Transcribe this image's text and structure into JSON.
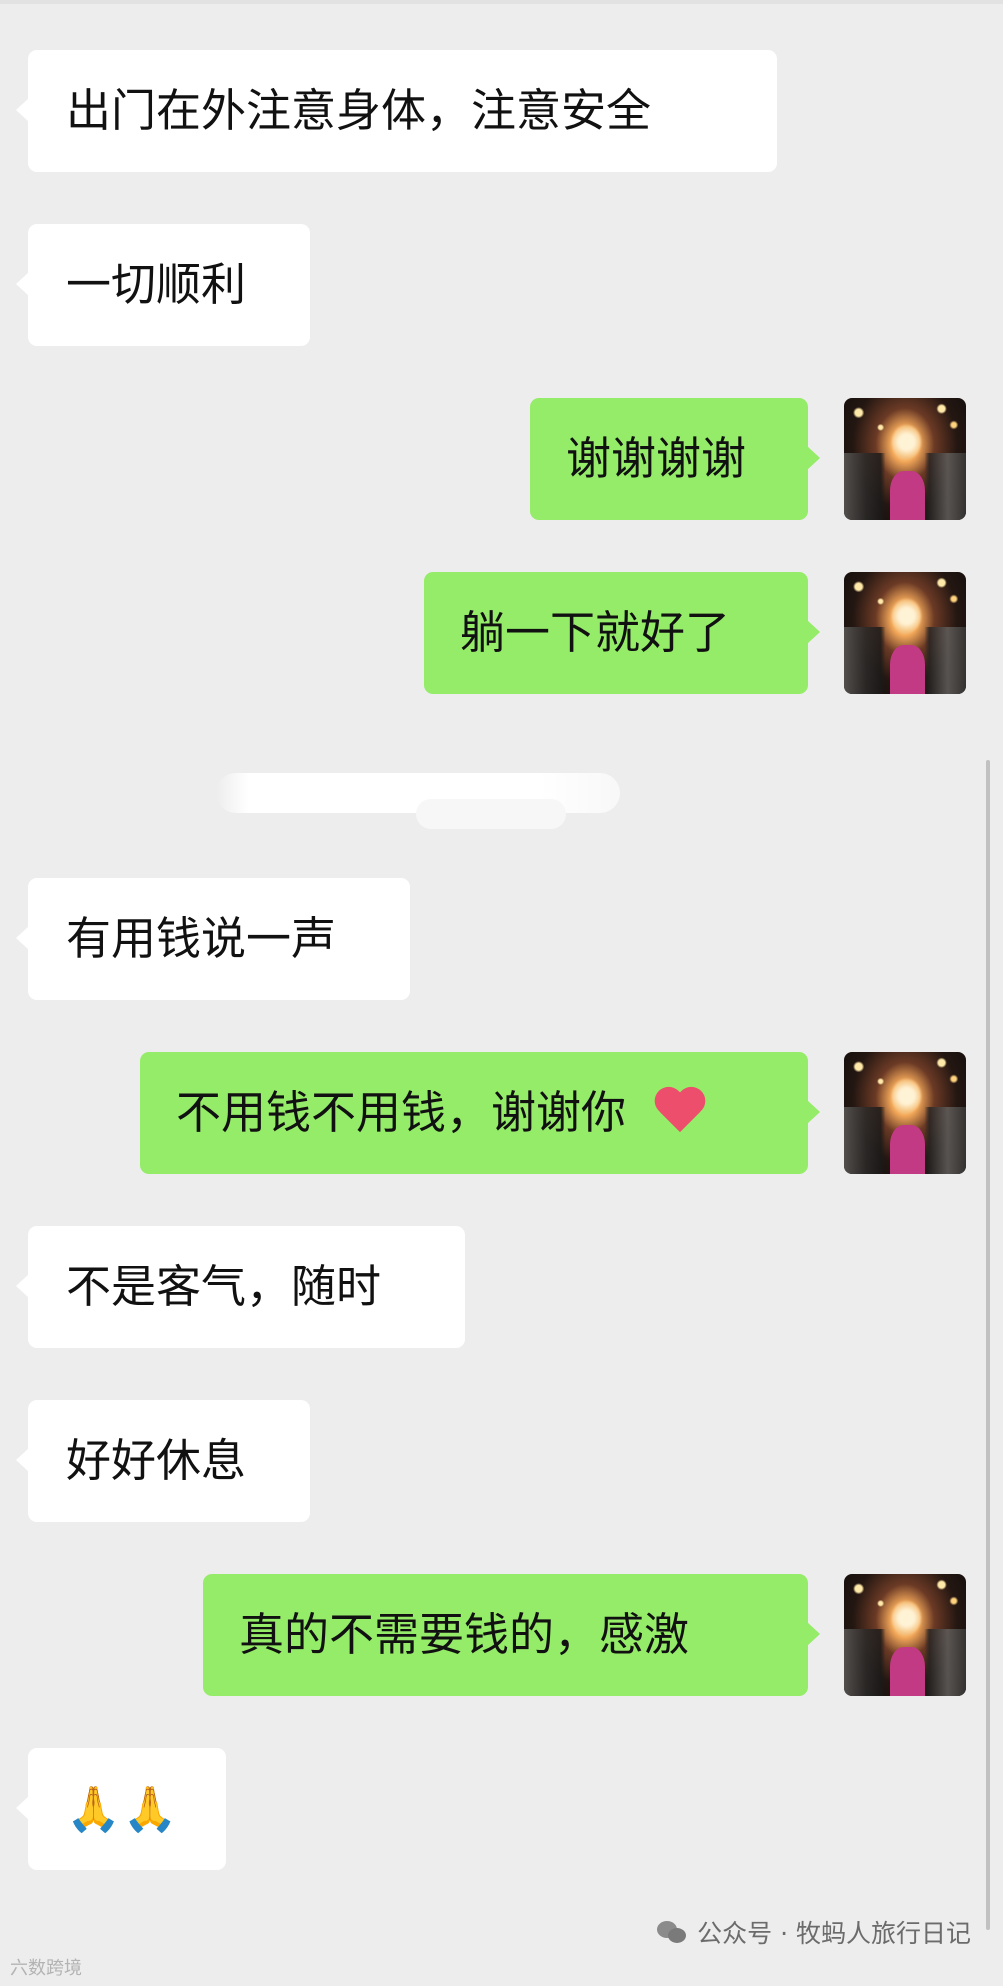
{
  "messages": [
    {
      "side": "in",
      "text": "出门在外注意身体，注意安全"
    },
    {
      "side": "in",
      "text": "一切顺利"
    },
    {
      "side": "out",
      "text": "谢谢谢谢"
    },
    {
      "side": "out",
      "text": "躺一下就好了"
    },
    {
      "side": "in",
      "text": "有用钱说一声"
    },
    {
      "side": "out",
      "text": "不用钱不用钱，谢谢你",
      "emoji": "heart-emoji"
    },
    {
      "side": "in",
      "text": "不是客气，随时"
    },
    {
      "side": "in",
      "text": "好好休息"
    },
    {
      "side": "out",
      "text": "真的不需要钱的，感激"
    },
    {
      "side": "in",
      "text": "🙏🙏",
      "emoji": "praying-hands-emoji"
    }
  ],
  "watermark": {
    "account_label": "公众号 · 牧蚂人旅行日记",
    "corner_label": "六数跨境"
  },
  "colors": {
    "background": "#ededed",
    "incoming_bubble": "#ffffff",
    "outgoing_bubble": "#95ec69",
    "text": "#111111"
  }
}
